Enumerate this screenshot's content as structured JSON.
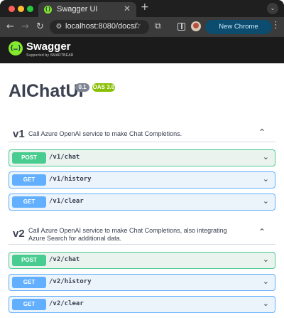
{
  "browser": {
    "tab_title": "Swagger UI",
    "tab_close": "✕",
    "new_tab": "+",
    "tab_search": "⌄",
    "back": "←",
    "forward": "→",
    "reload": "↻",
    "url": "localhost:8080/docs/",
    "star": "☆",
    "extensions": "⧉",
    "menu": "⋮",
    "chrome_update_label": "New Chrome available",
    "icons": [
      "back-arrow-icon",
      "forward-arrow-icon",
      "reload-icon",
      "site-info-icon",
      "bookmark-star-icon",
      "extensions-icon",
      "side-panel-icon",
      "profile-avatar-icon",
      "menu-dots-icon"
    ]
  },
  "topbar": {
    "logo_mark": "{…}",
    "logo_text": "Swagger",
    "logo_sub": "Supported by SMARTBEAR"
  },
  "info": {
    "title": "AIChatUI",
    "version": "0.1",
    "oas": "OAS 3.0"
  },
  "sections": [
    {
      "name": "v1",
      "description": "Call Azure OpenAI service to make Chat Completions.",
      "chevron": "⌃",
      "operations": [
        {
          "method": "POST",
          "path": "/v1/chat",
          "chevron": "⌄"
        },
        {
          "method": "GET",
          "path": "/v1/history",
          "chevron": "⌄"
        },
        {
          "method": "GET",
          "path": "/v1/clear",
          "chevron": "⌄"
        }
      ]
    },
    {
      "name": "v2",
      "description": "Call Azure OpenAI service to make Chat Completions, also integrating Azure Search for additional data.",
      "chevron": "⌃",
      "operations": [
        {
          "method": "POST",
          "path": "/v2/chat",
          "chevron": "⌄"
        },
        {
          "method": "GET",
          "path": "/v2/history",
          "chevron": "⌄"
        },
        {
          "method": "GET",
          "path": "/v2/clear",
          "chevron": "⌄"
        }
      ]
    }
  ],
  "colors": {
    "post": "#49cc90",
    "get": "#61affe",
    "swagger_green": "#85ea2d",
    "topbar": "#1b1b1b"
  }
}
